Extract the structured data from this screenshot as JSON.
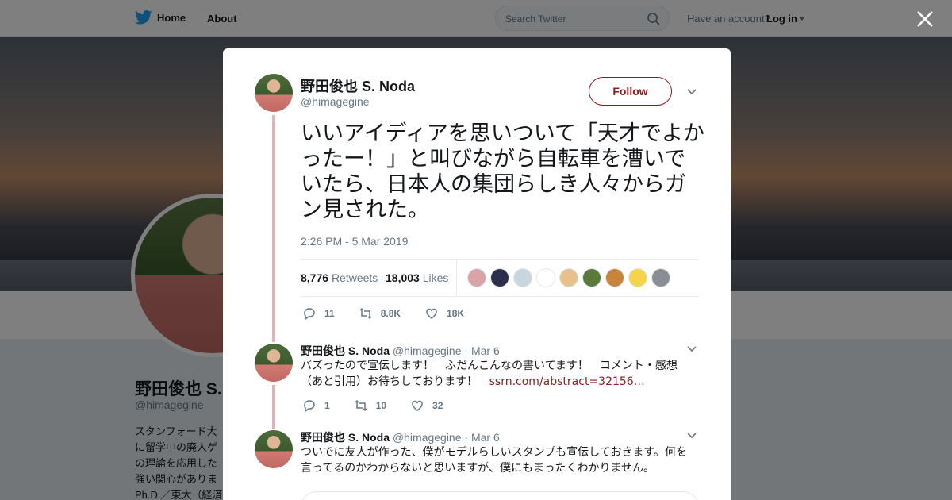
{
  "nav": {
    "home_label": "Home",
    "about_label": "About",
    "search_placeholder": "Search Twitter",
    "have_account": "Have an account?",
    "login_label": "Log in"
  },
  "profile": {
    "name": "野田俊也 S. Noda",
    "handle": "@himagegine",
    "bio_lines": [
      "スタンフォード大",
      "に留学中の廃人ゲ",
      "の理論を応用した",
      "強い関心がありま",
      "Ph.D.／東大（経済"
    ]
  },
  "tweet": {
    "name": "野田俊也 S. Noda",
    "handle": "@himagegine",
    "follow_label": "Follow",
    "text": "いいアイディアを思いついて「天才でよかったー！」と叫びながら自転車を漕いでいたら、日本人の集団らしき人々からガン見された。",
    "timestamp": "2:26 PM - 5 Mar 2019",
    "retweets_count": "8,776",
    "retweets_label": "Retweets",
    "likes_count": "18,003",
    "likes_label": "Likes",
    "liker_colors": [
      "#d9a3a8",
      "#2b2f4a",
      "#c9d6df",
      "#ffffff",
      "#e8c08a",
      "#5a7a3a",
      "#c8843a",
      "#f5d34a",
      "#8a8e94"
    ],
    "reply_count": "11",
    "retweet_short": "8.8K",
    "like_short": "18K"
  },
  "replies": [
    {
      "name": "野田俊也 S. Noda",
      "handle": "@himagegine",
      "date": "· Mar 6",
      "text": "バズったので宣伝します！　ふだんこんなの書いてます！　コメント・感想（あと引用）お待ちしております！",
      "link": "ssrn.com/abstract=32156…",
      "reply_count": "1",
      "retweet_count": "10",
      "like_count": "32"
    },
    {
      "name": "野田俊也 S. Noda",
      "handle": "@himagegine",
      "date": "· Mar 6",
      "text": "ついでに友人が作った、僕がモデルらしいスタンプも宣伝しておきます。何を言ってるのかわからないと思いますが、僕にもまったくわかりません。"
    }
  ],
  "colors": {
    "brand_blue": "#1da1f2",
    "accent_red": "#8b1a1e",
    "thread_line": "#e0b4b8"
  }
}
